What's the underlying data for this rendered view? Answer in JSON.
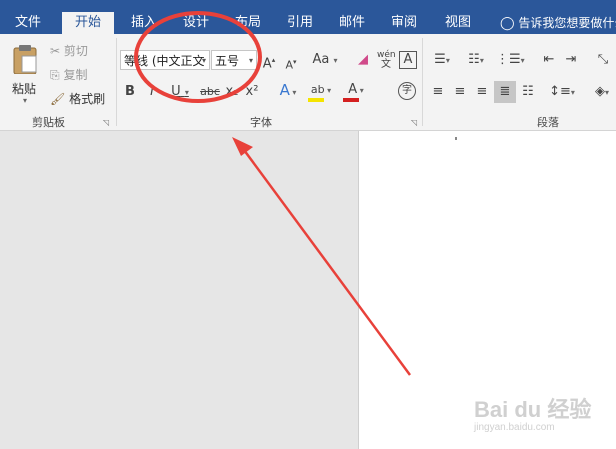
{
  "tabs": [
    "文件",
    "开始",
    "插入",
    "设计",
    "布局",
    "引用",
    "邮件",
    "审阅",
    "视图"
  ],
  "tell_me": "告诉我您想要做什么",
  "clipboard": {
    "paste": "粘贴",
    "cut": "剪切",
    "copy": "复制",
    "format_painter": "格式刷",
    "group": "剪贴板"
  },
  "font": {
    "font_name": "等线 (中文正文",
    "font_size": "五号",
    "grow": "A",
    "shrink": "A",
    "case": "Aa",
    "bold": "B",
    "italic": "I",
    "underline": "U",
    "strike": "abc",
    "subscript": "x₂",
    "superscript": "x²",
    "effects": "A",
    "highlight": "ab",
    "font_color": "A",
    "phonetic": "wén",
    "border_char": "A",
    "enclose": "字",
    "group": "字体"
  },
  "paragraph": {
    "group": "段落"
  },
  "watermark": {
    "brand": "Bai du 经验",
    "url": "jingyan.baidu.com"
  },
  "colors": {
    "accent": "#2b579a",
    "annotation": "#e8413a",
    "highlight": "#f5e400",
    "font_color": "#d42020"
  }
}
